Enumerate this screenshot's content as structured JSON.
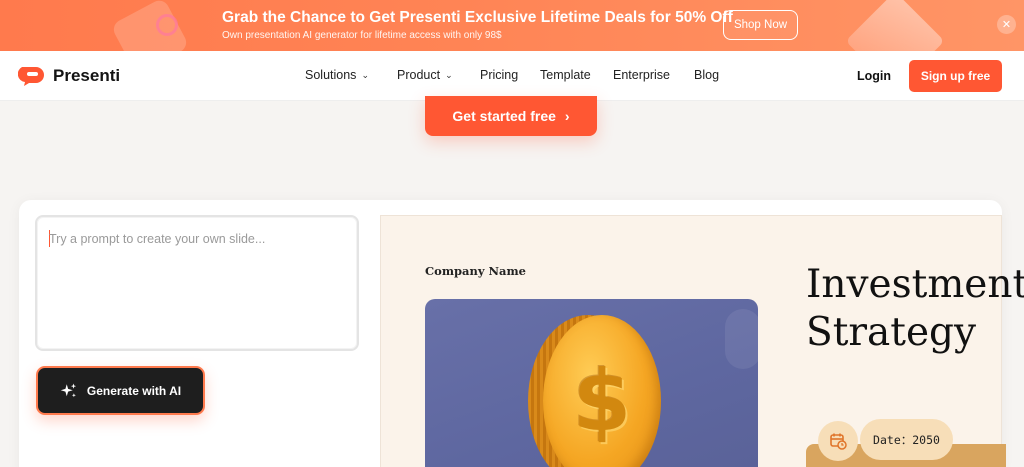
{
  "promo": {
    "title": "Grab the Chance to Get Presenti Exclusive Lifetime Deals for 50% Off",
    "subtitle": "Own presentation AI generator for lifetime access with only 98$",
    "shop_label": "Shop Now",
    "close_glyph": "✕",
    "accent": "#ff7a4d"
  },
  "nav": {
    "brand": "Presenti",
    "items": [
      {
        "label": "Solutions",
        "has_menu": true
      },
      {
        "label": "Product",
        "has_menu": true
      },
      {
        "label": "Pricing",
        "has_menu": false
      },
      {
        "label": "Template",
        "has_menu": false
      },
      {
        "label": "Enterprise",
        "has_menu": false
      },
      {
        "label": "Blog",
        "has_menu": false
      }
    ],
    "login_label": "Login",
    "signup_label": "Sign up free"
  },
  "hero": {
    "cta_label": "Get started free",
    "cta_arrow": "›",
    "brand_color": "#ff5733"
  },
  "generator": {
    "prompt_placeholder": "Try a prompt to create your own slide...",
    "prompt_value": "",
    "generate_label": "Generate with AI",
    "generate_icon": "sparkle-icon"
  },
  "slide": {
    "company": "Company Name",
    "title": "Investment\nStrategy",
    "date_label": "Date：2050",
    "image": "gold-dollar-coin",
    "calendar_icon": "calendar-clock-icon"
  }
}
